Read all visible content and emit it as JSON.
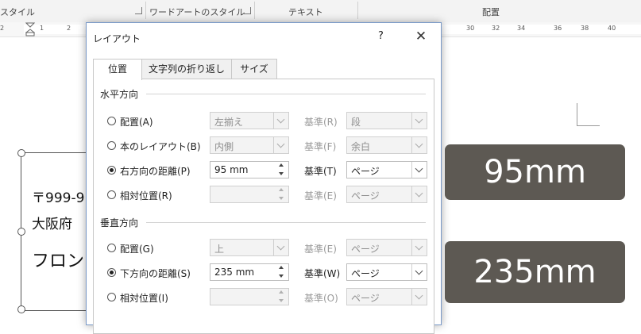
{
  "ribbon": {
    "groups": [
      "スタイル",
      "ワードアートのスタイル",
      "テキスト",
      "配置"
    ]
  },
  "ruler": {
    "ticks": [
      "2",
      "1",
      "2",
      "30",
      "32",
      "34",
      "36",
      "38",
      "40"
    ]
  },
  "document": {
    "lines": [
      "〒999-9",
      "大阪府",
      "フロン"
    ]
  },
  "dialog": {
    "title": "レイアウト",
    "help": "?",
    "close": "✕",
    "tabs": [
      "位置",
      "文字列の折り返し",
      "サイズ"
    ],
    "horizontal": {
      "heading": "水平方向",
      "rows": [
        {
          "label": "配置(A)",
          "value": "左揃え",
          "base_label": "基準(R)",
          "base_value": "段",
          "selected": false
        },
        {
          "label": "本のレイアウト(B)",
          "value": "内側",
          "base_label": "基準(F)",
          "base_value": "余白",
          "selected": false
        },
        {
          "label": "右方向の距離(P)",
          "value": "95 mm",
          "base_label": "基準(T)",
          "base_value": "ページ",
          "selected": true
        },
        {
          "label": "相対位置(R)",
          "value": "",
          "base_label": "基準(E)",
          "base_value": "ページ",
          "selected": false
        }
      ]
    },
    "vertical": {
      "heading": "垂直方向",
      "rows": [
        {
          "label": "配置(G)",
          "value": "上",
          "base_label": "基準(E)",
          "base_value": "ページ",
          "selected": false
        },
        {
          "label": "下方向の距離(S)",
          "value": "235 mm",
          "base_label": "基準(W)",
          "base_value": "ページ",
          "selected": true
        },
        {
          "label": "相対位置(I)",
          "value": "",
          "base_label": "基準(O)",
          "base_value": "ページ",
          "selected": false
        }
      ]
    }
  },
  "callouts": [
    "95mm",
    "235mm"
  ]
}
